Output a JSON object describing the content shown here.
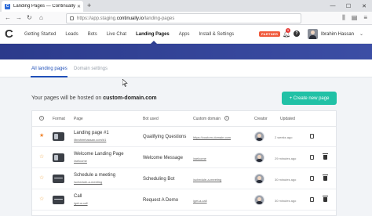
{
  "browser": {
    "tab_title": "Landing Pages — Continually",
    "tab_favicon": "C",
    "url_host": "https://app.staging.",
    "url_domain": "continually.io",
    "url_path": "/landing-pages"
  },
  "header": {
    "logo": "C",
    "nav": [
      {
        "label": "Getting Started"
      },
      {
        "label": "Leads"
      },
      {
        "label": "Bots"
      },
      {
        "label": "Live Chat"
      },
      {
        "label": "Landing Pages"
      },
      {
        "label": "Apps"
      },
      {
        "label": "Install & Settings"
      }
    ],
    "partner_badge": "PARTNER",
    "notification_count": "9",
    "user_name": "Ibrahim Hassan"
  },
  "subtabs": {
    "active": "All landing pages",
    "inactive": "Domain settings"
  },
  "main": {
    "host_prefix": "Your pages will be hosted on ",
    "host_domain": "custom-domain.com",
    "create_button": "+ Create new page"
  },
  "table": {
    "headers": {
      "format": "Format",
      "page": "Page",
      "bot_used": "Bot used",
      "custom_domain": "Custom domain",
      "creator": "Creator",
      "updated": "Updated"
    },
    "rows": [
      {
        "name": "Landing page #1",
        "url": "/ibrahimhassan.com/#1",
        "bot": "Qualifying Questions",
        "domain": "https://custom-domain.com",
        "updated": "2 weeks ago",
        "starred": true,
        "format": "chat"
      },
      {
        "name": "Welcome Landing Page",
        "url": "/welcome",
        "bot": "Welcome Message",
        "domain": "/welcome",
        "updated": "29 minutes ago",
        "starred": false,
        "format": "chat"
      },
      {
        "name": "Schedule a meeting",
        "url": "/schedule-a-meeting",
        "bot": "Scheduling Bot",
        "domain": "/schedule-a-meeting",
        "updated": "30 minutes ago",
        "starred": false,
        "format": "form"
      },
      {
        "name": "Call",
        "url": "/get-a-call",
        "bot": "Request A Demo",
        "domain": "/get-a-call",
        "updated": "30 minutes ago",
        "starred": false,
        "format": "form"
      }
    ]
  },
  "colors": {
    "brand_blue": "#2b3a8b",
    "accent_teal": "#21c1a6",
    "link_blue": "#1f4fb8",
    "star_orange": "#f0852d",
    "partner_red": "#f05a3c"
  }
}
